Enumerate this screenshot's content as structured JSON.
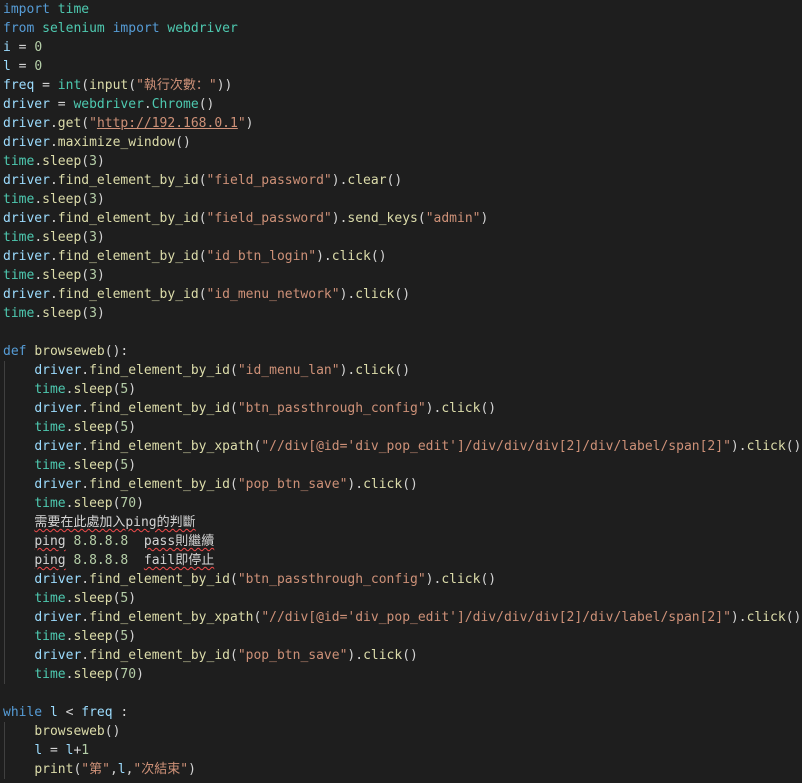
{
  "editor": {
    "language": "python",
    "colors": {
      "background": "#1e1e1e",
      "keyword": "#569cd6",
      "module": "#4ec9b0",
      "variable": "#9cdcfe",
      "function": "#dcdcaa",
      "number": "#b5cea8",
      "string": "#ce9178",
      "text": "#d4d4d4",
      "error_squiggle": "#f14c4c"
    },
    "lines": [
      [
        [
          "kw",
          "import"
        ],
        [
          "txt",
          " "
        ],
        [
          "mod",
          "time"
        ]
      ],
      [
        [
          "kw",
          "from"
        ],
        [
          "txt",
          " "
        ],
        [
          "mod",
          "selenium"
        ],
        [
          "txt",
          " "
        ],
        [
          "kw",
          "import"
        ],
        [
          "txt",
          " "
        ],
        [
          "mod",
          "webdriver"
        ]
      ],
      [
        [
          "var",
          "i"
        ],
        [
          "txt",
          " = "
        ],
        [
          "num",
          "0"
        ]
      ],
      [
        [
          "var",
          "l"
        ],
        [
          "txt",
          " = "
        ],
        [
          "num",
          "0"
        ]
      ],
      [
        [
          "var",
          "freq"
        ],
        [
          "txt",
          " = "
        ],
        [
          "mod",
          "int"
        ],
        [
          "txt",
          "("
        ],
        [
          "fn",
          "input"
        ],
        [
          "txt",
          "("
        ],
        [
          "str",
          "\"執行次數："
        ],
        [
          "str",
          "\""
        ],
        [
          "txt",
          "))"
        ]
      ],
      [
        [
          "var",
          "driver"
        ],
        [
          "txt",
          " = "
        ],
        [
          "mod",
          "webdriver"
        ],
        [
          "txt",
          "."
        ],
        [
          "mod",
          "Chrome"
        ],
        [
          "txt",
          "()"
        ]
      ],
      [
        [
          "var",
          "driver"
        ],
        [
          "txt",
          "."
        ],
        [
          "fn",
          "get"
        ],
        [
          "txt",
          "("
        ],
        [
          "str",
          "\""
        ],
        [
          "url",
          "http://192.168.0.1"
        ],
        [
          "str",
          "\""
        ],
        [
          "txt",
          ")"
        ]
      ],
      [
        [
          "var",
          "driver"
        ],
        [
          "txt",
          "."
        ],
        [
          "fn",
          "maximize_window"
        ],
        [
          "txt",
          "()"
        ]
      ],
      [
        [
          "mod",
          "time"
        ],
        [
          "txt",
          "."
        ],
        [
          "fn",
          "sleep"
        ],
        [
          "txt",
          "("
        ],
        [
          "num",
          "3"
        ],
        [
          "txt",
          ")"
        ]
      ],
      [
        [
          "var",
          "driver"
        ],
        [
          "txt",
          "."
        ],
        [
          "fn",
          "find_element_by_id"
        ],
        [
          "txt",
          "("
        ],
        [
          "str",
          "\"field_password\""
        ],
        [
          "txt",
          ")."
        ],
        [
          "fn",
          "clear"
        ],
        [
          "txt",
          "()"
        ]
      ],
      [
        [
          "mod",
          "time"
        ],
        [
          "txt",
          "."
        ],
        [
          "fn",
          "sleep"
        ],
        [
          "txt",
          "("
        ],
        [
          "num",
          "3"
        ],
        [
          "txt",
          ")"
        ]
      ],
      [
        [
          "var",
          "driver"
        ],
        [
          "txt",
          "."
        ],
        [
          "fn",
          "find_element_by_id"
        ],
        [
          "txt",
          "("
        ],
        [
          "str",
          "\"field_password\""
        ],
        [
          "txt",
          ")."
        ],
        [
          "fn",
          "send_keys"
        ],
        [
          "txt",
          "("
        ],
        [
          "str",
          "\"admin\""
        ],
        [
          "txt",
          ")"
        ]
      ],
      [
        [
          "mod",
          "time"
        ],
        [
          "txt",
          "."
        ],
        [
          "fn",
          "sleep"
        ],
        [
          "txt",
          "("
        ],
        [
          "num",
          "3"
        ],
        [
          "txt",
          ")"
        ]
      ],
      [
        [
          "var",
          "driver"
        ],
        [
          "txt",
          "."
        ],
        [
          "fn",
          "find_element_by_id"
        ],
        [
          "txt",
          "("
        ],
        [
          "str",
          "\"id_btn_login\""
        ],
        [
          "txt",
          ")."
        ],
        [
          "fn",
          "click"
        ],
        [
          "txt",
          "()"
        ]
      ],
      [
        [
          "mod",
          "time"
        ],
        [
          "txt",
          "."
        ],
        [
          "fn",
          "sleep"
        ],
        [
          "txt",
          "("
        ],
        [
          "num",
          "3"
        ],
        [
          "txt",
          ")"
        ]
      ],
      [
        [
          "var",
          "driver"
        ],
        [
          "txt",
          "."
        ],
        [
          "fn",
          "find_element_by_id"
        ],
        [
          "txt",
          "("
        ],
        [
          "str",
          "\"id_menu_network\""
        ],
        [
          "txt",
          ")."
        ],
        [
          "fn",
          "click"
        ],
        [
          "txt",
          "()"
        ]
      ],
      [
        [
          "mod",
          "time"
        ],
        [
          "txt",
          "."
        ],
        [
          "fn",
          "sleep"
        ],
        [
          "txt",
          "("
        ],
        [
          "num",
          "3"
        ],
        [
          "txt",
          ")"
        ]
      ],
      [],
      [
        [
          "kw",
          "def"
        ],
        [
          "txt",
          " "
        ],
        [
          "fn",
          "browseweb"
        ],
        [
          "txt",
          "():"
        ]
      ],
      [
        [
          "txt",
          "    "
        ],
        [
          "var",
          "driver"
        ],
        [
          "txt",
          "."
        ],
        [
          "fn",
          "find_element_by_id"
        ],
        [
          "txt",
          "("
        ],
        [
          "str",
          "\"id_menu_lan\""
        ],
        [
          "txt",
          ")."
        ],
        [
          "fn",
          "click"
        ],
        [
          "txt",
          "()"
        ]
      ],
      [
        [
          "txt",
          "    "
        ],
        [
          "mod",
          "time"
        ],
        [
          "txt",
          "."
        ],
        [
          "fn",
          "sleep"
        ],
        [
          "txt",
          "("
        ],
        [
          "num",
          "5"
        ],
        [
          "txt",
          ")"
        ]
      ],
      [
        [
          "txt",
          "    "
        ],
        [
          "var",
          "driver"
        ],
        [
          "txt",
          "."
        ],
        [
          "fn",
          "find_element_by_id"
        ],
        [
          "txt",
          "("
        ],
        [
          "str",
          "\"btn_passthrough_config\""
        ],
        [
          "txt",
          ")."
        ],
        [
          "fn",
          "click"
        ],
        [
          "txt",
          "()"
        ]
      ],
      [
        [
          "txt",
          "    "
        ],
        [
          "mod",
          "time"
        ],
        [
          "txt",
          "."
        ],
        [
          "fn",
          "sleep"
        ],
        [
          "txt",
          "("
        ],
        [
          "num",
          "5"
        ],
        [
          "txt",
          ")"
        ]
      ],
      [
        [
          "txt",
          "    "
        ],
        [
          "var",
          "driver"
        ],
        [
          "txt",
          "."
        ],
        [
          "fn",
          "find_element_by_xpath"
        ],
        [
          "txt",
          "("
        ],
        [
          "str",
          "\"//div[@id='div_pop_edit']/div/div/div[2]/div/label/span[2]\""
        ],
        [
          "txt",
          ")."
        ],
        [
          "fn",
          "click"
        ],
        [
          "txt",
          "()"
        ]
      ],
      [
        [
          "txt",
          "    "
        ],
        [
          "mod",
          "time"
        ],
        [
          "txt",
          "."
        ],
        [
          "fn",
          "sleep"
        ],
        [
          "txt",
          "("
        ],
        [
          "num",
          "5"
        ],
        [
          "txt",
          ")"
        ]
      ],
      [
        [
          "txt",
          "    "
        ],
        [
          "var",
          "driver"
        ],
        [
          "txt",
          "."
        ],
        [
          "fn",
          "find_element_by_id"
        ],
        [
          "txt",
          "("
        ],
        [
          "str",
          "\"pop_btn_save\""
        ],
        [
          "txt",
          ")."
        ],
        [
          "fn",
          "click"
        ],
        [
          "txt",
          "()"
        ]
      ],
      [
        [
          "txt",
          "    "
        ],
        [
          "mod",
          "time"
        ],
        [
          "txt",
          "."
        ],
        [
          "fn",
          "sleep"
        ],
        [
          "txt",
          "("
        ],
        [
          "num",
          "70"
        ],
        [
          "txt",
          ")"
        ]
      ],
      [
        [
          "txt",
          "    "
        ],
        [
          "squig",
          "需要在此處加入ping的判斷"
        ]
      ],
      [
        [
          "txt",
          "    "
        ],
        [
          "squig",
          "ping"
        ],
        [
          "txt",
          " "
        ],
        [
          "num",
          "8.8.8.8"
        ],
        [
          "txt",
          "  "
        ],
        [
          "squig",
          "pass則繼續"
        ]
      ],
      [
        [
          "txt",
          "    "
        ],
        [
          "squig",
          "ping"
        ],
        [
          "txt",
          " "
        ],
        [
          "num",
          "8.8.8.8"
        ],
        [
          "txt",
          "  "
        ],
        [
          "squig",
          "fail即停止"
        ]
      ],
      [
        [
          "txt",
          "    "
        ],
        [
          "var",
          "driver"
        ],
        [
          "txt",
          "."
        ],
        [
          "fn",
          "find_element_by_id"
        ],
        [
          "txt",
          "("
        ],
        [
          "str",
          "\"btn_passthrough_config\""
        ],
        [
          "txt",
          ")."
        ],
        [
          "fn",
          "click"
        ],
        [
          "txt",
          "()"
        ]
      ],
      [
        [
          "txt",
          "    "
        ],
        [
          "mod",
          "time"
        ],
        [
          "txt",
          "."
        ],
        [
          "fn",
          "sleep"
        ],
        [
          "txt",
          "("
        ],
        [
          "num",
          "5"
        ],
        [
          "txt",
          ")"
        ]
      ],
      [
        [
          "txt",
          "    "
        ],
        [
          "var",
          "driver"
        ],
        [
          "txt",
          "."
        ],
        [
          "fn",
          "find_element_by_xpath"
        ],
        [
          "txt",
          "("
        ],
        [
          "str",
          "\"//div[@id='div_pop_edit']/div/div/div[2]/div/label/span[2]\""
        ],
        [
          "txt",
          ")."
        ],
        [
          "fn",
          "click"
        ],
        [
          "txt",
          "()"
        ]
      ],
      [
        [
          "txt",
          "    "
        ],
        [
          "mod",
          "time"
        ],
        [
          "txt",
          "."
        ],
        [
          "fn",
          "sleep"
        ],
        [
          "txt",
          "("
        ],
        [
          "num",
          "5"
        ],
        [
          "txt",
          ")"
        ]
      ],
      [
        [
          "txt",
          "    "
        ],
        [
          "var",
          "driver"
        ],
        [
          "txt",
          "."
        ],
        [
          "fn",
          "find_element_by_id"
        ],
        [
          "txt",
          "("
        ],
        [
          "str",
          "\"pop_btn_save\""
        ],
        [
          "txt",
          ")."
        ],
        [
          "fn",
          "click"
        ],
        [
          "txt",
          "()"
        ]
      ],
      [
        [
          "txt",
          "    "
        ],
        [
          "mod",
          "time"
        ],
        [
          "txt",
          "."
        ],
        [
          "fn",
          "sleep"
        ],
        [
          "txt",
          "("
        ],
        [
          "num",
          "70"
        ],
        [
          "txt",
          ")"
        ]
      ],
      [],
      [
        [
          "kw",
          "while"
        ],
        [
          "txt",
          " "
        ],
        [
          "var",
          "l"
        ],
        [
          "txt",
          " < "
        ],
        [
          "var",
          "freq"
        ],
        [
          "txt",
          " :"
        ]
      ],
      [
        [
          "txt",
          "    "
        ],
        [
          "fn",
          "browseweb"
        ],
        [
          "txt",
          "()"
        ]
      ],
      [
        [
          "txt",
          "    "
        ],
        [
          "var",
          "l"
        ],
        [
          "txt",
          " = "
        ],
        [
          "var",
          "l"
        ],
        [
          "txt",
          "+"
        ],
        [
          "num",
          "1"
        ]
      ],
      [
        [
          "txt",
          "    "
        ],
        [
          "fn",
          "print"
        ],
        [
          "txt",
          "("
        ],
        [
          "str",
          "\"第\""
        ],
        [
          "txt",
          ","
        ],
        [
          "var",
          "l"
        ],
        [
          "txt",
          ","
        ],
        [
          "str",
          "\"次結束\""
        ],
        [
          "txt",
          ")"
        ]
      ]
    ]
  }
}
